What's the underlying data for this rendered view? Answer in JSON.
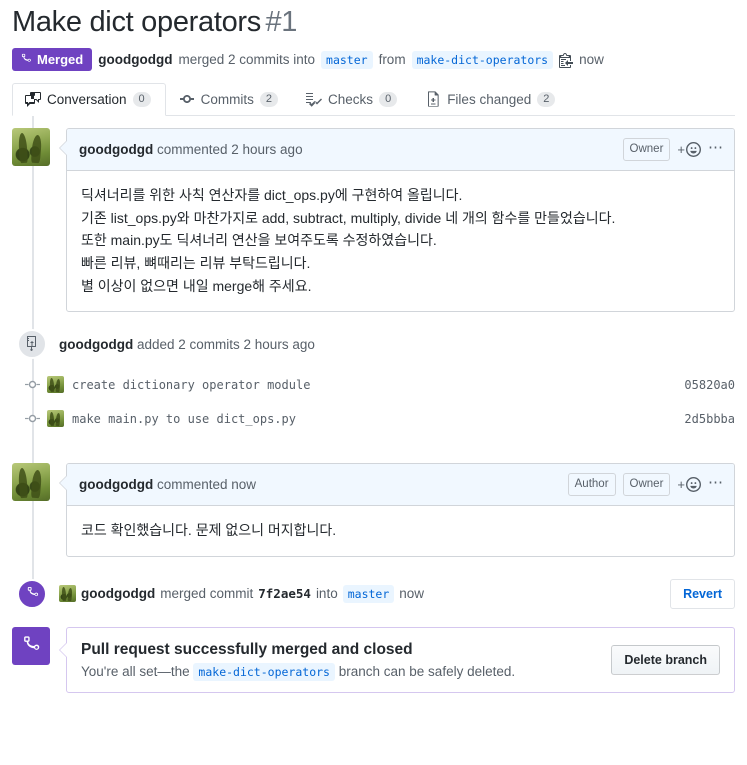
{
  "pr": {
    "title": "Make dict operators",
    "number": "#1",
    "state_label": "Merged",
    "merged_by": "goodgodgd",
    "merged_text": "merged 2 commits into",
    "base_branch": "master",
    "from_text": "from",
    "head_branch": "make-dict-operators",
    "merged_time": "now",
    "copy_icon": "clipboard-copy-icon"
  },
  "tabs": [
    {
      "label": "Conversation",
      "count": "0",
      "icon": "comment-discussion-icon",
      "selected": true
    },
    {
      "label": "Commits",
      "count": "2",
      "icon": "git-commit-icon",
      "selected": false
    },
    {
      "label": "Checks",
      "count": "0",
      "icon": "checklist-icon",
      "selected": false
    },
    {
      "label": "Files changed",
      "count": "2",
      "icon": "file-diff-icon",
      "selected": false
    }
  ],
  "comments": [
    {
      "author": "goodgodgd",
      "action": "commented 2 hours ago",
      "badges": [
        "Owner"
      ],
      "reaction_label": "+",
      "kebab_label": "⋯",
      "lines": [
        "딕셔너리를 위한 사칙 연산자를 dict_ops.py에 구현하여 올립니다.",
        "기존 list_ops.py와 마찬가지로 add, subtract, multiply, divide 네 개의 함수를 만들었습니다.",
        "또한 main.py도 딕셔너리 연산을 보여주도록 수정하였습니다.",
        "빠른 리뷰, 뼈때리는 리뷰 부탁드립니다.",
        "별 이상이 없으면 내일 merge해 주세요."
      ]
    },
    {
      "author": "goodgodgd",
      "action": "commented now",
      "badges": [
        "Author",
        "Owner"
      ],
      "reaction_label": "+",
      "kebab_label": "⋯",
      "lines": [
        "코드 확인했습니다. 문제 없으니 머지합니다."
      ]
    }
  ],
  "commits_event": {
    "icon": "repo-push-icon",
    "author": "goodgodgd",
    "text": "added 2 commits 2 hours ago",
    "commits": [
      {
        "message": "create dictionary operator module",
        "sha": "05820a0",
        "dot_icon": "commit-dot-icon"
      },
      {
        "message": "make main.py to use dict_ops.py",
        "sha": "2d5bbba",
        "dot_icon": "commit-dot-icon"
      }
    ]
  },
  "merge_event": {
    "icon": "git-merge-icon",
    "author": "goodgodgd",
    "action_pre": "merged commit",
    "sha": "7f2ae54",
    "action_mid": "into",
    "branch": "master",
    "time": "now",
    "revert_label": "Revert"
  },
  "merged_banner": {
    "icon": "git-merge-icon",
    "title": "Pull request successfully merged and closed",
    "sub_pre": "You're all set—the",
    "branch": "make-dict-operators",
    "sub_post": "branch can be safely deleted.",
    "delete_label": "Delete branch"
  },
  "colors": {
    "merged_purple": "#6f42c1",
    "link_blue": "#0366d6",
    "branch_chip_bg": "#eaf5ff",
    "border": "#e1e4e8",
    "comment_head_bg": "#f1f8ff",
    "muted_text": "#586069"
  }
}
